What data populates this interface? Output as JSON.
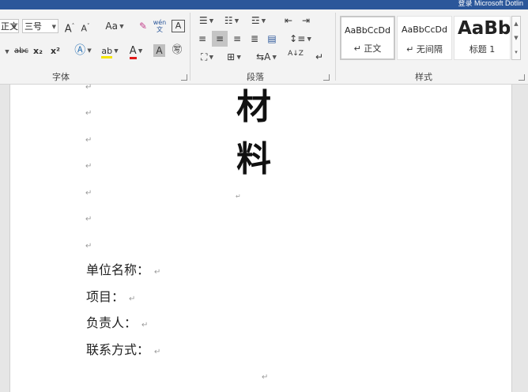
{
  "window": {
    "account_text": "登录  Microsoft Dotlin"
  },
  "font_group": {
    "font_name": "正文",
    "font_size": "三号",
    "change_case": "Aa",
    "phonetic": "wén\n文",
    "strikethrough": "abc",
    "subscript": "x₂",
    "superscript": "x²",
    "label": "字体"
  },
  "paragraph_group": {
    "sort_label": "A↓Z",
    "label": "段落"
  },
  "styles_group": {
    "label": "样式",
    "items": [
      {
        "preview": "AaBbCcDd",
        "name": "↵ 正文"
      },
      {
        "preview": "AaBbCcDd",
        "name": "↵ 无间隔"
      },
      {
        "preview": "AaBb",
        "name": "标题 1"
      }
    ]
  },
  "document": {
    "title_chars": [
      "材",
      "料"
    ],
    "paragraph_mark": "↵",
    "fields": [
      {
        "label": "单位名称："
      },
      {
        "label": "项目："
      },
      {
        "label": "负责人："
      },
      {
        "label": "联系方式："
      }
    ]
  }
}
